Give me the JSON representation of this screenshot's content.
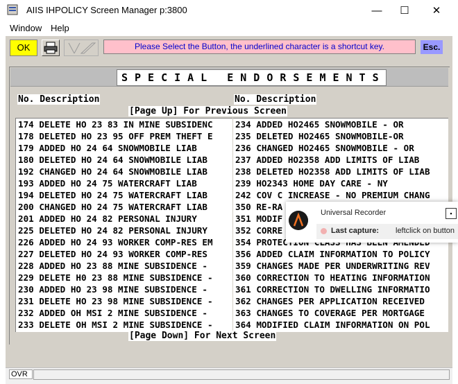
{
  "window": {
    "title": "AIIS IHPOLICY Screen Manager p:3800",
    "minimize": "—",
    "maximize": "☐",
    "close": "✕"
  },
  "menu": {
    "window": "Window",
    "help": "Help"
  },
  "toolbar": {
    "ok": "OK",
    "message": "Please Select the Button, the underlined character is a shortcut key.",
    "esc": "Esc."
  },
  "screen": {
    "title": "SPECIAL ENDORSEMENTS",
    "col_header_left": "No. Description",
    "col_header_right": "No. Description",
    "page_up": "[Page Up] For Previous Screen",
    "page_down": "[Page Down] For Next Screen",
    "left_items": [
      "174 DELETE HO 23 83 IN MINE SUBSIDENC",
      "178 DELETED HO 23 95 OFF PREM THEFT E",
      "179 ADDED HO 24 64 SNOWMOBILE LIAB",
      "180 DELETED HO 24 64 SNOWMOBILE LIAB",
      "192 CHANGED HO 24 64 SNOWMOBILE LIAB",
      "193 ADDED HO 24 75 WATERCRAFT LIAB",
      "194 DELETED HO 24 75 WATERCRAFT LIAB",
      "200 CHANGED HO 24 75 WATERCRAFT LIAB",
      "201 ADDED HO 24 82 PERSONAL INJURY",
      "225 DELETED HO 24 82 PERSONAL INJURY",
      "226 ADDED HO 24 93 WORKER COMP-RES EM",
      "227 DELETED HO 24 93 WORKER COMP-RES",
      "228 ADDED HO 23 88 MINE SUBSIDENCE -",
      "229 DELETE H0 23 88 MINE SUBSIDENCE -",
      "230 ADDED HO 23 98 MINE SUBSIDENCE -",
      "231 DELETE HO 23 98 MINE SUBSIDENCE -",
      "232 ADDED OH MSI 2 MINE SUBSIDENCE -",
      "233 DELETE OH MSI 2 MINE SUBSIDENCE -"
    ],
    "right_items": [
      "234 ADDED HO2465 SNOWMOBILE - OR",
      "235 DELETED HO2465 SNOWMOBILE-OR",
      "236 CHANGED HO2465 SNOWMOBILE - OR",
      "237 ADDED HO2358 ADD LIMITS OF LIAB",
      "238 DELETED HO2358 ADD LIMITS OF LIAB",
      "239 HO2343 HOME DAY CARE - NY",
      "242 COV C INCREASE - NO PREMIUM CHANG",
      "350 RE-RA",
      "351 MODIF",
      "352 CORRE",
      "354 PROTECTION CLASS HAS BEEN AMENDED",
      "356 ADDED CLAIM INFORMATION TO POLICY",
      "359 CHANGES MADE PER UNDERWRITING REV",
      "360 CORRECTION TO HEATING INFORMATION",
      "361 CORRECTION TO DWELLING INFORMATIO",
      "362 CHANGES PER APPLICATION RECEIVED",
      "363 CHANGES TO COVERAGE PER MORTGAGE",
      "364 MODIFIED CLAIM INFORMATION ON POL"
    ]
  },
  "popup": {
    "title": "Universal Recorder",
    "label": "Last capture:",
    "value": "leftclick on button"
  },
  "status": {
    "mode": "OVR"
  }
}
